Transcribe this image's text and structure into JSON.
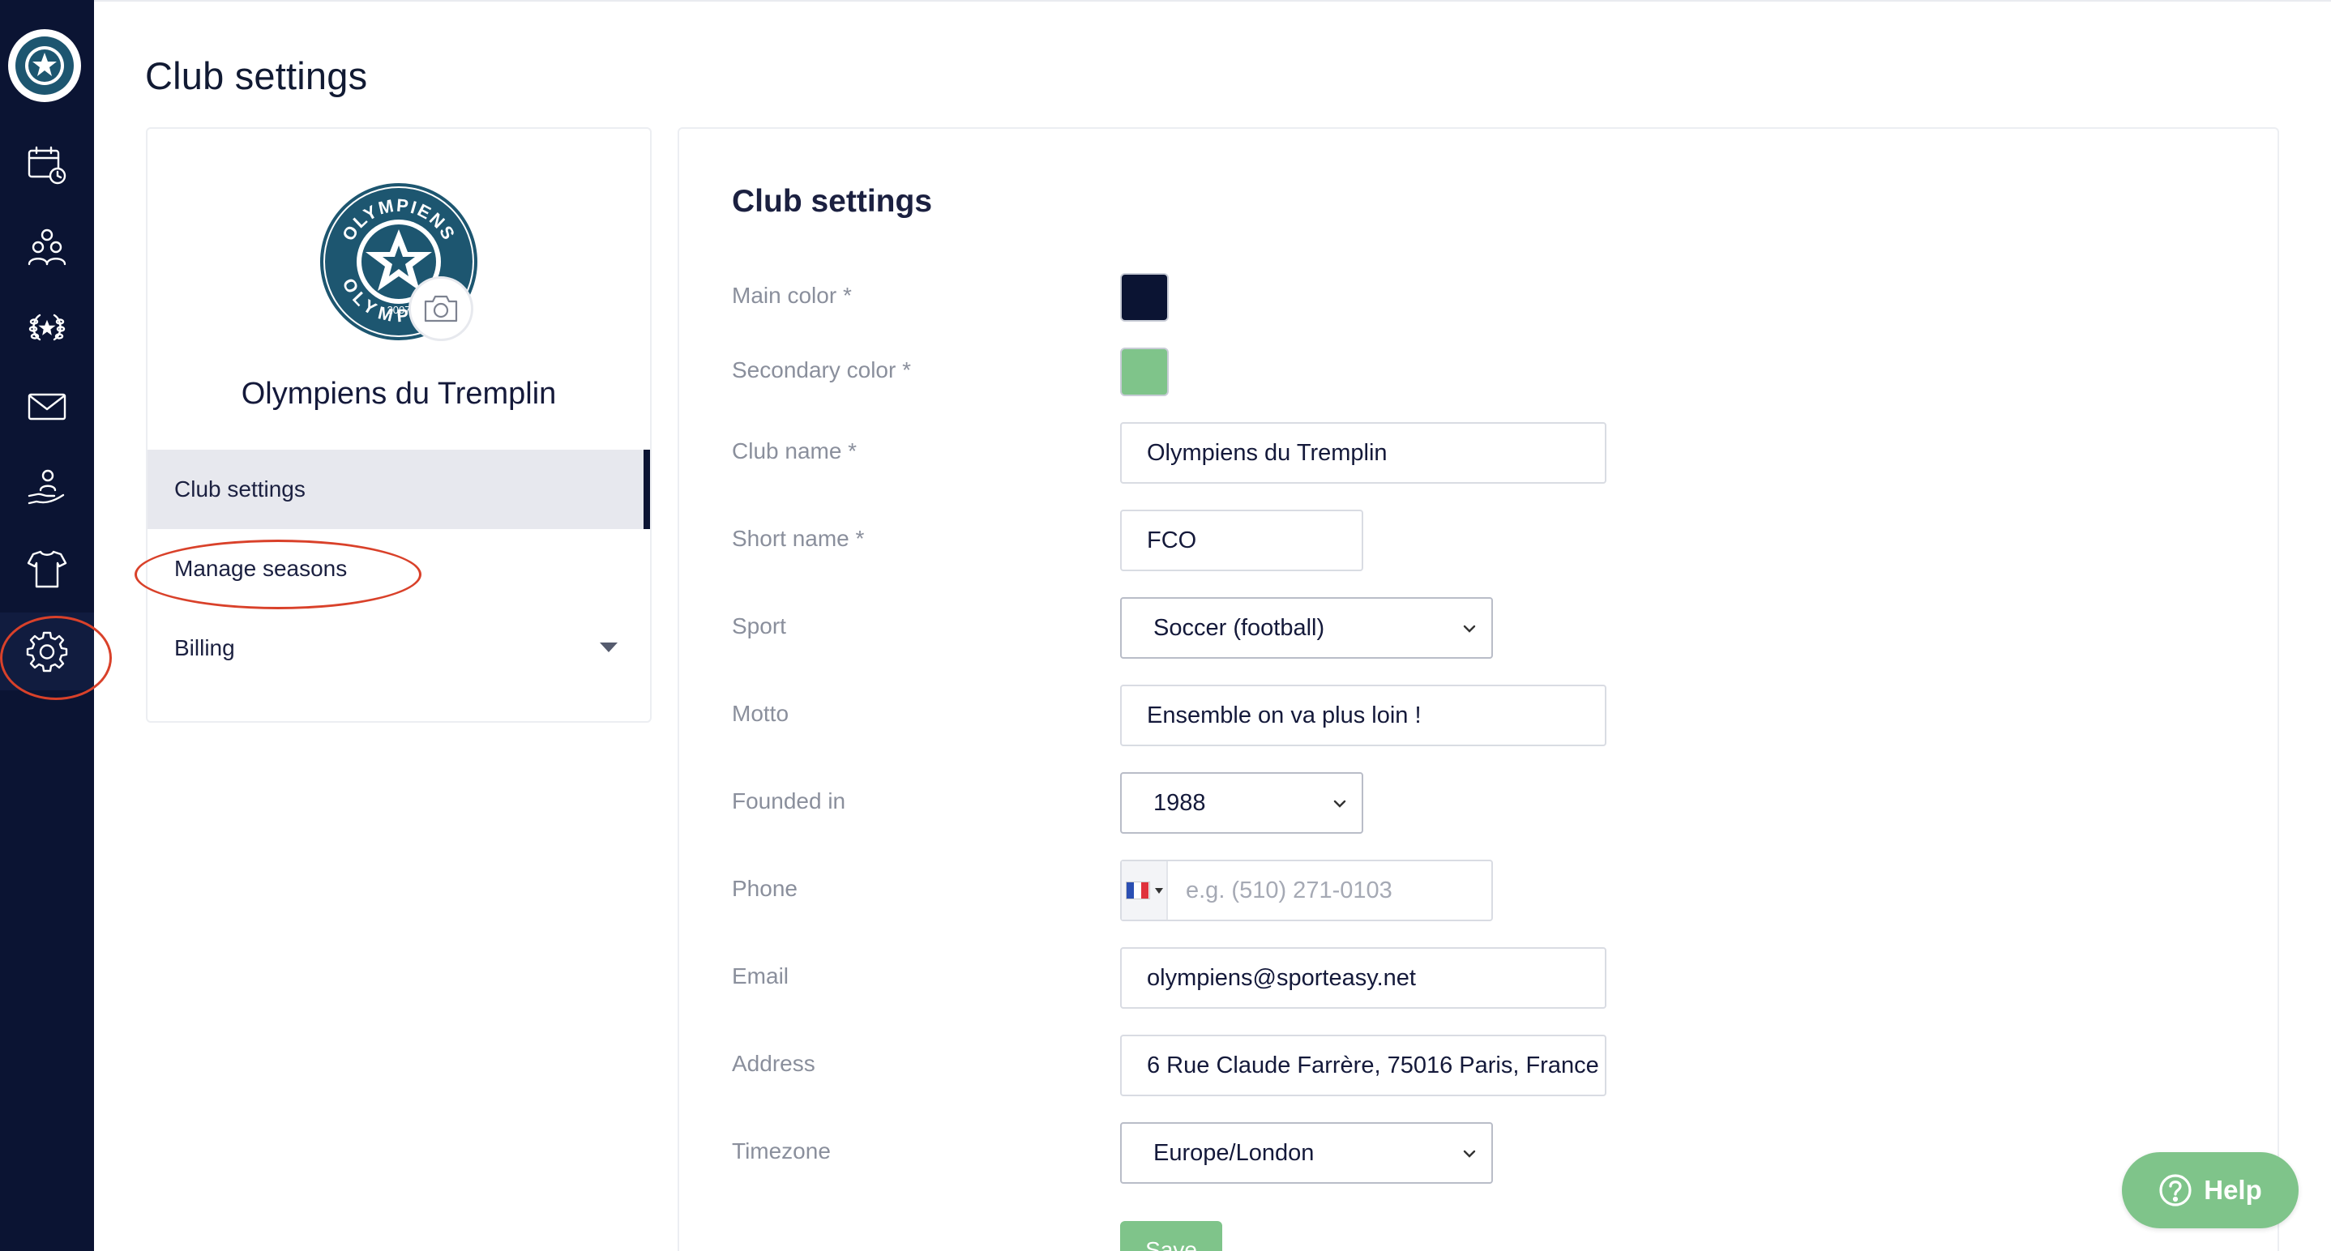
{
  "page": {
    "title": "Club settings"
  },
  "nav": {
    "items": [
      {
        "icon": "calendar-icon"
      },
      {
        "icon": "members-icon"
      },
      {
        "icon": "laurel-icon"
      },
      {
        "icon": "mail-icon"
      },
      {
        "icon": "hand-person-icon"
      },
      {
        "icon": "jersey-icon"
      },
      {
        "icon": "gear-icon",
        "active": true
      }
    ]
  },
  "profile": {
    "club_name": "Olympiens du Tremplin",
    "logo_text_top": "OLYMPIENS",
    "logo_text_bottom": "OLYMPIENS",
    "logo_year": "2007",
    "menu": [
      {
        "label": "Club settings",
        "active": true
      },
      {
        "label": "Manage seasons"
      },
      {
        "label": "Billing",
        "has_caret": true
      }
    ]
  },
  "form": {
    "title": "Club settings",
    "labels": {
      "main_color": "Main color *",
      "secondary_color": "Secondary color *",
      "club_name": "Club name *",
      "short_name": "Short name *",
      "sport": "Sport",
      "motto": "Motto",
      "founded_in": "Founded in",
      "phone": "Phone",
      "email": "Email",
      "address": "Address",
      "timezone": "Timezone"
    },
    "values": {
      "main_color": "#0b1433",
      "secondary_color": "#7fc48a",
      "club_name": "Olympiens du Tremplin",
      "short_name": "FCO",
      "sport": "Soccer (football)",
      "motto": "Ensemble on va plus loin !",
      "founded_in": "1988",
      "phone": "",
      "email": "olympiens@sporteasy.net",
      "address": "6 Rue Claude Farrère, 75016 Paris, France",
      "timezone": "Europe/London"
    },
    "placeholders": {
      "phone": "e.g. (510) 271-0103"
    },
    "save_label": "Save"
  },
  "help": {
    "label": "Help"
  },
  "colors": {
    "rail": "#0b1433",
    "accent_green": "#7fc48a",
    "annotation_red": "#d9412a"
  }
}
